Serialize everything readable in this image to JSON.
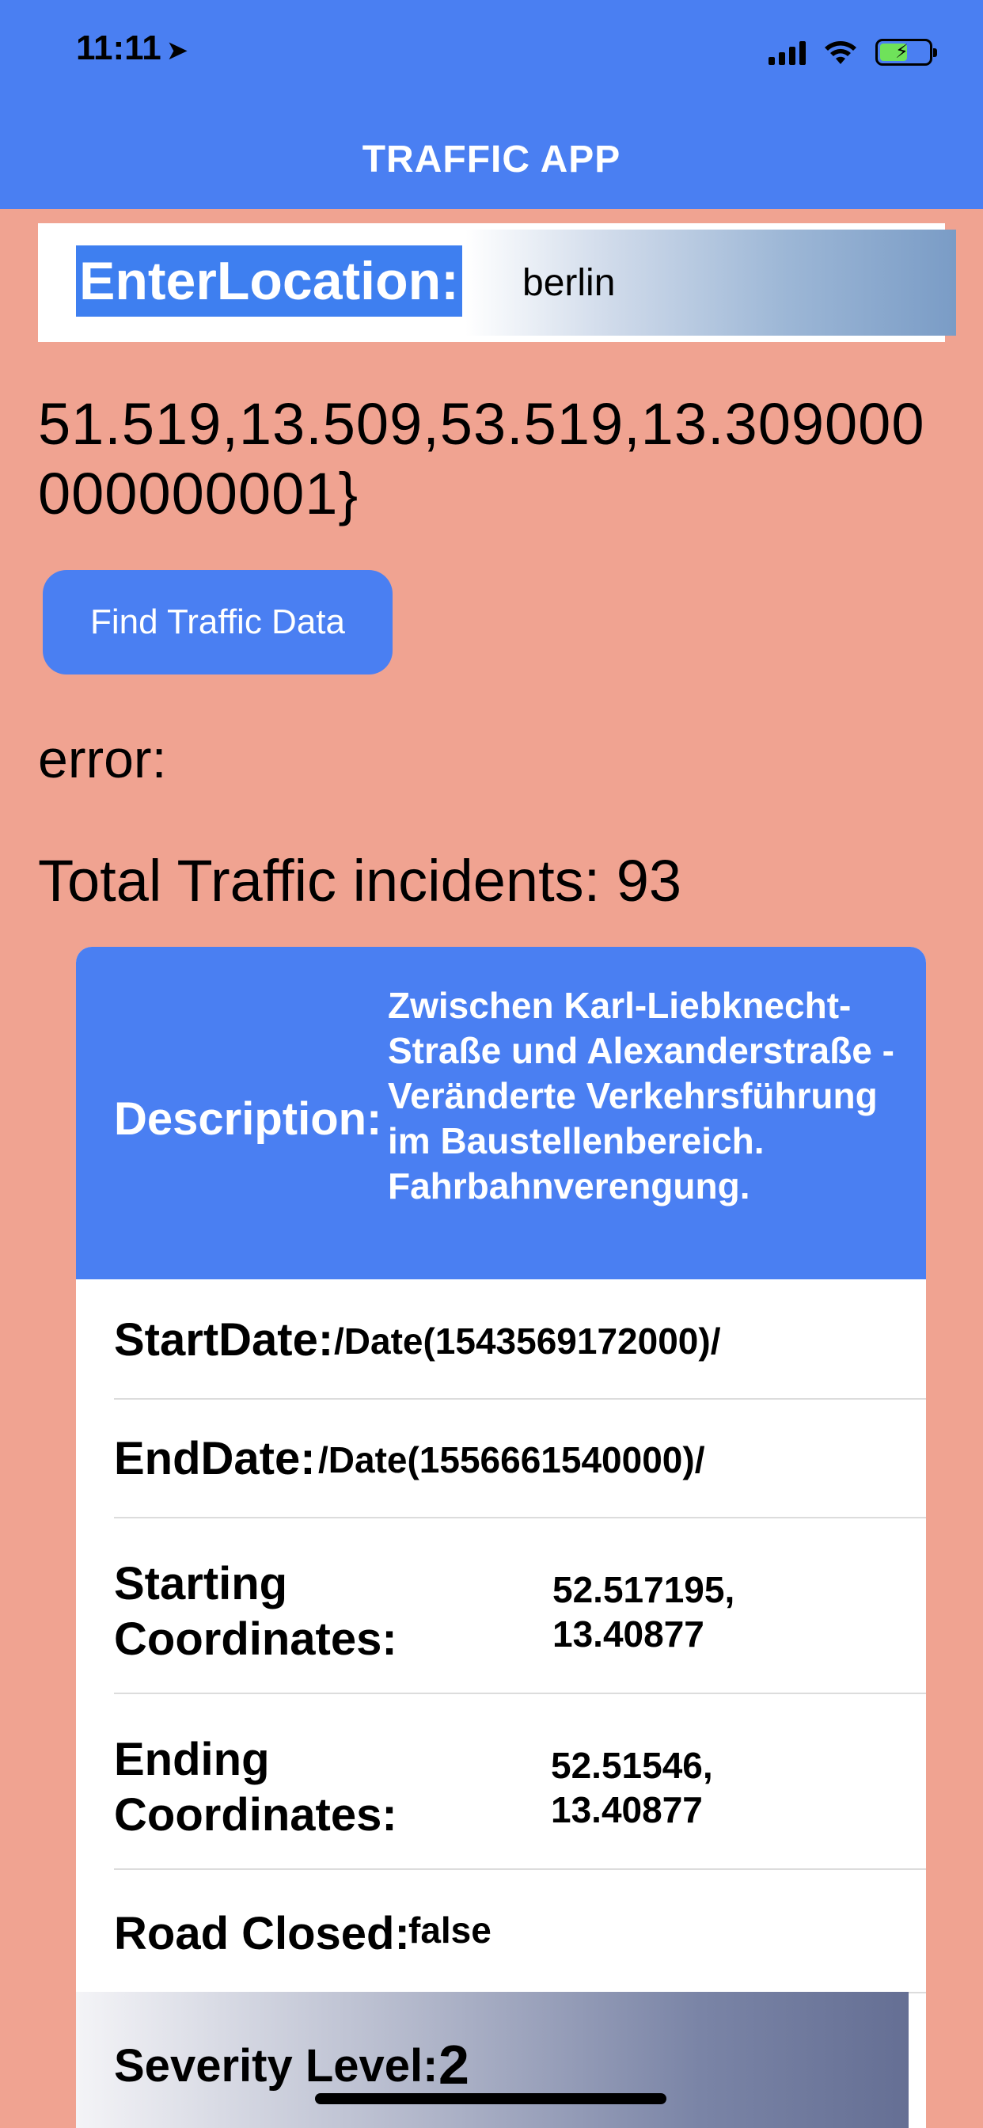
{
  "status_bar": {
    "time": "11:11",
    "location_arrow": "location-arrow-icon",
    "icons": [
      "signal-icon",
      "wifi-icon",
      "battery-charging-icon"
    ]
  },
  "header": {
    "title": "TRAFFIC APP",
    "background": "#4a7ff2"
  },
  "location": {
    "label": "EnterLocation:",
    "value": "berlin"
  },
  "bbox_text": "51.519,13.509,53.519,13.309000000000001}",
  "find_button": {
    "label": "Find Traffic Data"
  },
  "error_text": "error:",
  "total_text": "Total Traffic incidents: 93",
  "incident": {
    "description_label": "Description:",
    "description": "Zwischen Karl-Liebknecht-Straße und Alexanderstraße - Veränderte Verkehrsführung im Baustellenbereich. Fahrbahnverengung.",
    "start_date_label": "StartDate:",
    "start_date": "/Date(1543569172000)/",
    "end_date_label": "EndDate:",
    "end_date": "/Date(1556661540000)/",
    "starting_coordinates_label_1": "Starting",
    "starting_coordinates_label_2": "Coordinates:",
    "starting_coordinates_1": "52.517195,",
    "starting_coordinates_2": "13.40877",
    "ending_coordinates_label_1": "Ending",
    "ending_coordinates_label_2": "Coordinates:",
    "ending_coordinates_1": "52.51546,",
    "ending_coordinates_2": "13.40877",
    "road_closed_label": "Road Closed:",
    "road_closed": "false",
    "severity_label": "Severity Level:",
    "severity": "2"
  },
  "colors": {
    "background": "#f0a391",
    "accent": "#4a7ff2"
  }
}
